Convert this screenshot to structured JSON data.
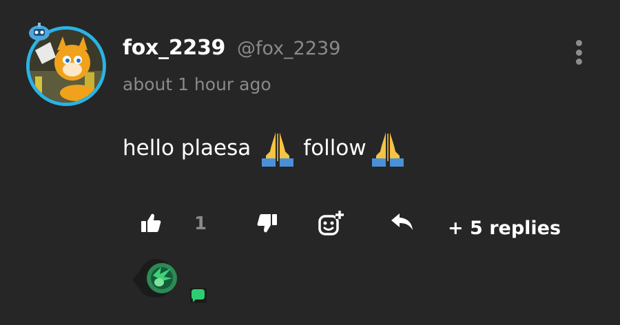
{
  "comment": {
    "author": {
      "username": "fox_2239",
      "handle": "@fox_2239",
      "avatar": "tails-fox-avatar",
      "badge": "blue-robot-badge-icon",
      "ring_color": "#2ab3e6"
    },
    "timestamp": "about 1 hour ago",
    "text_parts": [
      "hello plaesa",
      "follow"
    ],
    "emoji": "folded-hands-emoji",
    "actions": {
      "like_count": "1",
      "replies_label": "+ 5 replies"
    },
    "reply_preview": {
      "avatar": "green-hedgehog-avatar",
      "status_icon": "chat-bubble-icon",
      "status_color": "#2ecc71"
    }
  },
  "colors": {
    "background": "#262626",
    "primary_text": "#ffffff",
    "secondary_text": "#8a8a8a",
    "icon": "#ffffff"
  }
}
